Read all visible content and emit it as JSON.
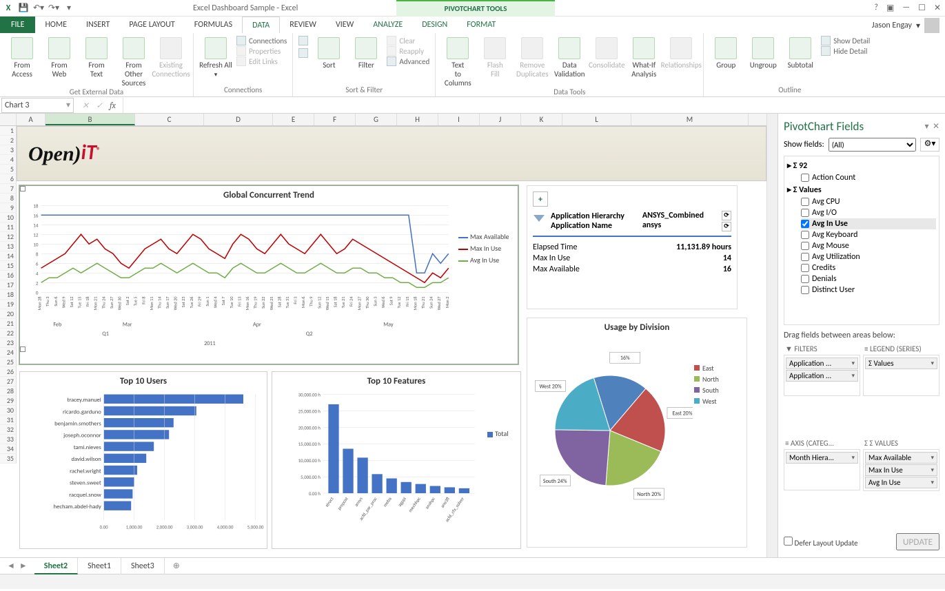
{
  "window": {
    "title": "Excel Dashboard Sample - Excel",
    "contextual_tab": "PIVOTCHART TOOLS",
    "user": "Jason Engay"
  },
  "qat": {
    "icons": [
      "excel",
      "save",
      "undo",
      "redo"
    ]
  },
  "ribbon_tabs": [
    "FILE",
    "HOME",
    "INSERT",
    "PAGE LAYOUT",
    "FORMULAS",
    "DATA",
    "REVIEW",
    "VIEW",
    "ANALYZE",
    "DESIGN",
    "FORMAT"
  ],
  "ribbon_active": "DATA",
  "ribbon": {
    "groups": [
      {
        "name": "Get External Data",
        "buttons": [
          "From Access",
          "From Web",
          "From Text",
          "From Other Sources",
          "Existing Connections"
        ]
      },
      {
        "name": "Connections",
        "big": "Refresh All",
        "small": [
          "Connections",
          "Properties",
          "Edit Links"
        ]
      },
      {
        "name": "Sort & Filter",
        "big": [
          "Sort",
          "Filter"
        ],
        "small": [
          "Clear",
          "Reapply",
          "Advanced"
        ]
      },
      {
        "name": "Data Tools",
        "buttons": [
          "Text to Columns",
          "Flash Fill",
          "Remove Duplicates",
          "Data Validation",
          "Consolidate",
          "What-If Analysis",
          "Relationships"
        ]
      },
      {
        "name": "Outline",
        "buttons": [
          "Group",
          "Ungroup",
          "Subtotal"
        ],
        "small": [
          "Show Detail",
          "Hide Detail"
        ]
      }
    ]
  },
  "name_box": "Chart 3",
  "columns": [
    "",
    "A",
    "B",
    "C",
    "D",
    "E",
    "F",
    "G",
    "H",
    "I",
    "J",
    "K",
    "L",
    "M"
  ],
  "rows_visible": 35,
  "logo_text": "Open)iT",
  "info_panel": {
    "application_hierarchy_lbl": "Application Hierarchy",
    "application_hierarchy_val": "ANSYS_Combined",
    "application_name_lbl": "Application Name",
    "application_name_val": "ansys",
    "metrics": [
      {
        "label": "Elapsed Time",
        "value": "11,131.89 hours"
      },
      {
        "label": "Max In Use",
        "value": "14"
      },
      {
        "label": "Max Available",
        "value": "16"
      }
    ]
  },
  "pivot_fields": {
    "title": "PivotChart Fields",
    "show_fields_lbl": "Show fields:",
    "show_fields_val": "(All)",
    "instr": "Drag fields between areas below:",
    "groups": [
      {
        "name": "Σ 92",
        "fields": [
          {
            "label": "Action Count",
            "checked": false
          }
        ]
      },
      {
        "name": "Σ Values",
        "fields": [
          {
            "label": "Avg CPU",
            "checked": false
          },
          {
            "label": "Avg I/O",
            "checked": false
          },
          {
            "label": "Avg In Use",
            "checked": true
          },
          {
            "label": "Avg Keyboard",
            "checked": false
          },
          {
            "label": "Avg Mouse",
            "checked": false
          },
          {
            "label": "Avg Utilization",
            "checked": false
          },
          {
            "label": "Credits",
            "checked": false
          },
          {
            "label": "Denials",
            "checked": false
          },
          {
            "label": "Distinct User",
            "checked": false
          }
        ]
      }
    ],
    "areas": {
      "filters": {
        "title": "FILTERS",
        "items": [
          "Application ...",
          "Application ..."
        ]
      },
      "legend": {
        "title": "LEGEND (SERIES)",
        "items": [
          "Σ Values"
        ]
      },
      "axis": {
        "title": "AXIS (CATEG...",
        "items": [
          "Month Hiera..."
        ]
      },
      "values": {
        "title": "Σ  VALUES",
        "items": [
          "Max Available",
          "Max In Use",
          "Avg In Use"
        ]
      }
    },
    "defer_lbl": "Defer Layout Update",
    "update_btn": "UPDATE"
  },
  "sheet_tabs": [
    "Sheet2",
    "Sheet1",
    "Sheet3"
  ],
  "sheet_active": "Sheet2",
  "chart_data": [
    {
      "type": "line",
      "title": "Global Concurrent Trend",
      "ylim": [
        0,
        18
      ],
      "yticks": [
        0,
        2,
        4,
        6,
        8,
        10,
        12,
        14,
        16,
        18
      ],
      "x_days": [
        "Mon 28",
        "Thu 3",
        "Sun 6",
        "Wed 9",
        "Sat 12",
        "Tue 15",
        "Fri 18",
        "Mon 21",
        "Thu 24",
        "Sun 27",
        "Wed 30",
        "Sat 2",
        "Tue 5",
        "Fri 8",
        "Mon 11",
        "Thu 14",
        "Sun 17",
        "Wed 20",
        "Sat 23",
        "Tue 26",
        "Fri 29",
        "Sun 1",
        "Wed 4",
        "Sat 7",
        "Tue 10",
        "Fri 13",
        "Mon 16",
        "Thu 19",
        "Sun 22",
        "Wed 25",
        "Sat 28",
        "Tue 31",
        "Fri 3",
        "Mon 6",
        "Thu 9",
        "Sun 12",
        "Wed 15",
        "Sat 18",
        "Tue 21",
        "Fri 24",
        "Mon 27",
        "Thu 30",
        "Sun 3",
        "Wed 6",
        "Sat 9",
        "Tue 12",
        "Fri 15",
        "Mon 18",
        "Thu 21",
        "Sun 24",
        "Wed 27",
        "Mon 2"
      ],
      "x_months": [
        "Feb",
        "Mar",
        "Apr",
        "May"
      ],
      "x_quarters": [
        "Q1",
        "Q2"
      ],
      "x_year": "2011",
      "series": [
        {
          "name": "Max Available",
          "color": "#4472c4",
          "values": [
            16,
            16,
            16,
            16,
            16,
            16,
            16,
            16,
            16,
            16,
            16,
            16,
            16,
            16,
            16,
            16,
            16,
            16,
            16,
            16,
            16,
            16,
            16,
            16,
            16,
            16,
            16,
            16,
            16,
            16,
            16,
            16,
            16,
            16,
            16,
            16,
            16,
            16,
            16,
            16,
            16,
            16,
            16,
            16,
            16,
            16,
            16,
            4,
            4,
            8,
            6,
            8
          ]
        },
        {
          "name": "Max In Use",
          "color": "#c00000",
          "values": [
            5,
            6,
            7,
            8,
            10,
            12,
            10,
            11,
            9,
            8,
            6,
            5,
            7,
            9,
            10,
            11,
            9,
            8,
            10,
            12,
            11,
            9,
            8,
            7,
            10,
            12,
            11,
            9,
            8,
            10,
            12,
            10,
            9,
            8,
            10,
            12,
            10,
            8,
            9,
            11,
            10,
            9,
            8,
            7,
            6,
            5,
            4,
            3,
            2,
            4,
            3,
            5
          ]
        },
        {
          "name": "Avg In Use",
          "color": "#70ad47",
          "values": [
            2,
            3,
            3,
            4,
            5,
            4,
            5,
            6,
            5,
            4,
            3,
            3,
            4,
            5,
            5,
            6,
            5,
            4,
            5,
            6,
            5,
            4,
            4,
            3,
            5,
            6,
            5,
            4,
            4,
            5,
            6,
            5,
            4,
            4,
            5,
            6,
            5,
            4,
            4,
            5,
            5,
            4,
            4,
            3,
            3,
            2,
            2,
            1,
            1,
            2,
            2,
            3
          ]
        }
      ]
    },
    {
      "type": "bar",
      "orientation": "horizontal",
      "title": "Top 10 Users",
      "xlabel": "",
      "xlim": [
        0,
        5000
      ],
      "xticks": [
        "0.00",
        "1,000.00",
        "2,000.00",
        "3,000.00",
        "4,000.00",
        "5,000.00"
      ],
      "categories": [
        "tracey.manuel",
        "ricardo.garduno",
        "benjamin.smothers",
        "joseph.oconnor",
        "tami.nieves",
        "david.wilson",
        "rachel.wright",
        "steven.sweet",
        "racquel.snow",
        "hecham.abdel-hady"
      ],
      "values": [
        4600,
        3050,
        2300,
        2150,
        1650,
        1400,
        1100,
        1000,
        950,
        900
      ],
      "color": "#4472c4"
    },
    {
      "type": "bar",
      "orientation": "vertical",
      "title": "Top 10 Features",
      "ylabel": "",
      "ylim": [
        0,
        30000
      ],
      "yticks": [
        "0.00 h",
        "5,000.00 h",
        "10,000.00 h",
        "15,000.00 h",
        "20,000.00 h",
        "25,000.00 h",
        "30,000.00 h"
      ],
      "categories": [
        "struct",
        "prepost",
        "ansys",
        "acfd_par_proc",
        "meba",
        "agppi",
        "mechhpc",
        "anshpc",
        "ane3fl",
        "acfd_cfx_solver"
      ],
      "series": [
        {
          "name": "Total",
          "color": "#4472c4",
          "values": [
            27000,
            13500,
            10800,
            5800,
            4500,
            3400,
            2800,
            2200,
            1800,
            1500
          ]
        }
      ]
    },
    {
      "type": "pie",
      "title": "Usage by Division",
      "categories": [
        "East",
        "North",
        "South",
        "West"
      ],
      "values": [
        20,
        20,
        24,
        20
      ],
      "labels": [
        "East 20%",
        "North 20%",
        "South 24%",
        "West 20%",
        "16%"
      ],
      "colors": {
        "East": "#c0504d",
        "North": "#9bbb59",
        "South": "#8064a2",
        "West": "#4bacc6",
        "_other": "#4f81bd"
      },
      "legend": [
        "East",
        "North",
        "South",
        "West"
      ]
    }
  ]
}
